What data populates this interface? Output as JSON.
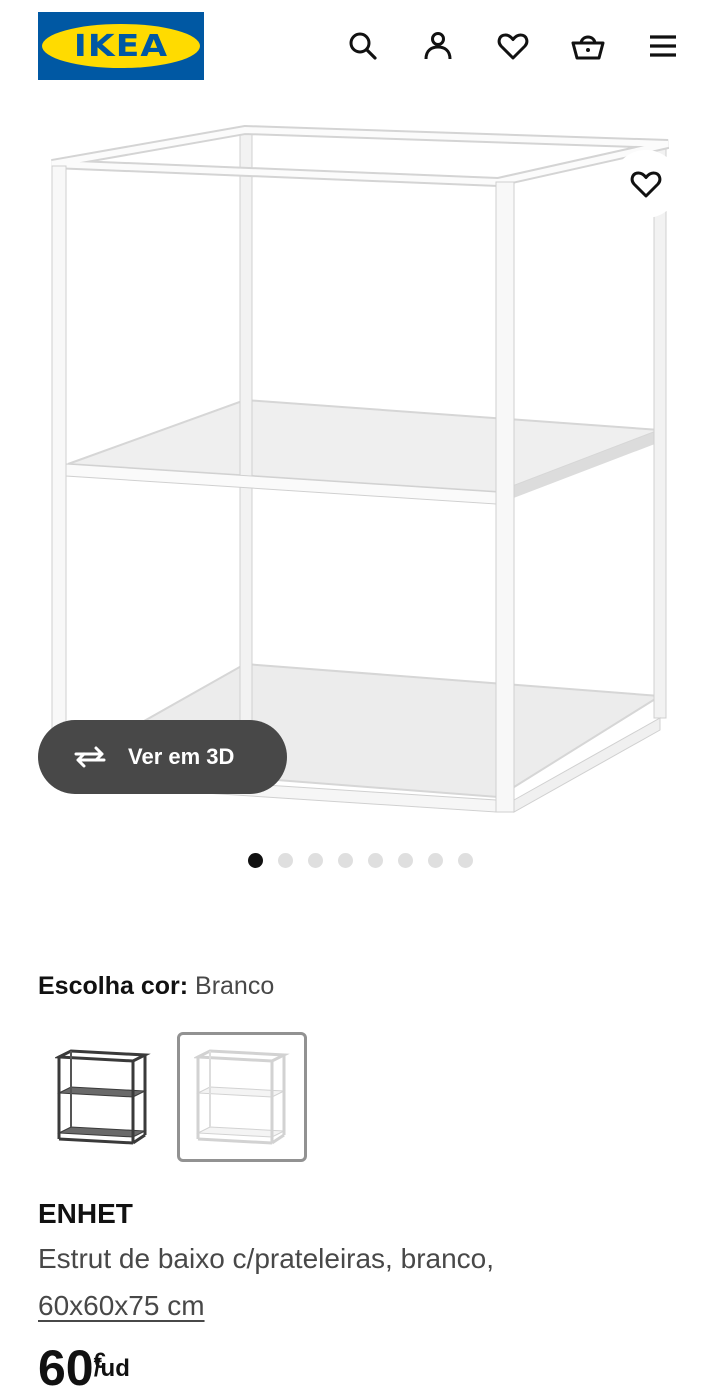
{
  "header": {
    "logo_text": "IKEA",
    "icons": [
      "search-icon",
      "account-icon",
      "heart-icon",
      "cart-icon",
      "menu-icon"
    ]
  },
  "hero": {
    "view_3d_label": "Ver em 3D",
    "image_count": 8,
    "active_image_index": 0
  },
  "color_selector": {
    "label": "Escolha cor:",
    "value": "Branco",
    "options": [
      "dark-grey",
      "white"
    ],
    "selected_option": "white"
  },
  "product": {
    "name": "ENHET",
    "description_line1": "Estrut de baixo c/prateleiras, branco,",
    "description_line2": "60x60x75 cm",
    "price_integer": "60",
    "price_currency": "€",
    "price_unit": "/ud"
  },
  "colors": {
    "ikea_blue": "#0058a3",
    "ikea_yellow": "#ffdb00",
    "button_dark": "#484848",
    "dot_active": "#111111",
    "dot_inactive": "#dfdfdf"
  }
}
